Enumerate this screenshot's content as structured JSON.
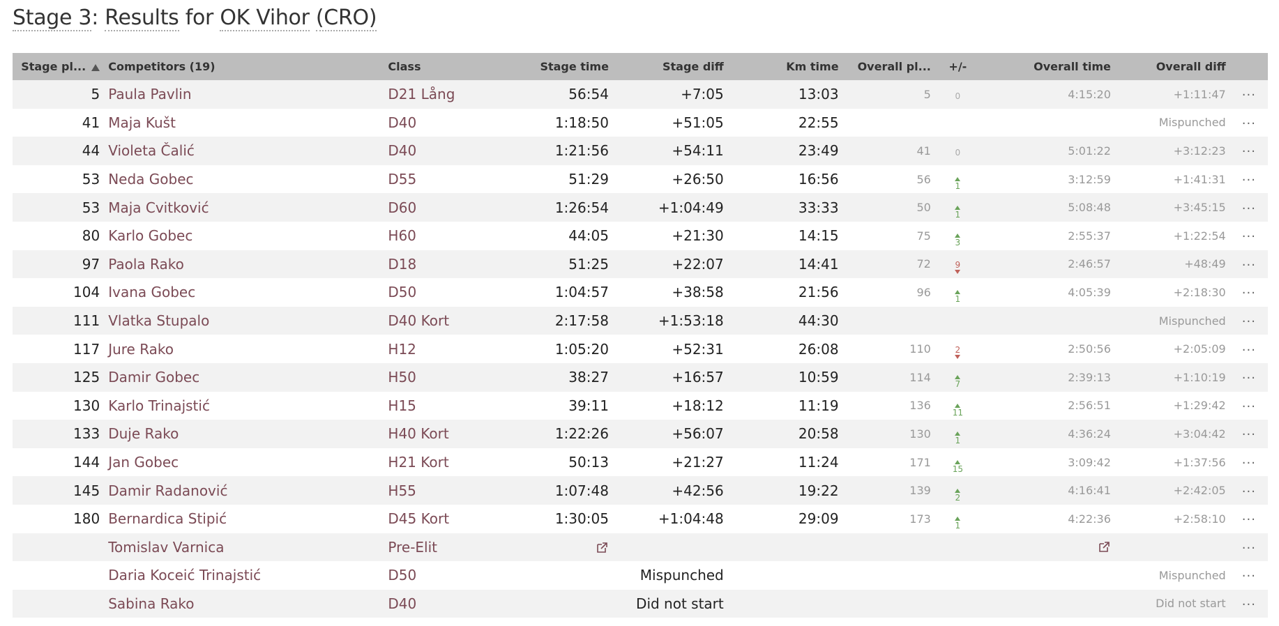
{
  "title": {
    "prefix": "Stage 3",
    "colon": ": ",
    "word1": "Results",
    "word2": " for ",
    "club": "OK Vihor",
    "space": " ",
    "country": "(CRO)"
  },
  "headers": {
    "stage_place": "Stage pl...",
    "competitors": "Competitors (19)",
    "class": "Class",
    "stage_time": "Stage time",
    "stage_diff": "Stage diff",
    "km_time": "Km time",
    "overall_place": "Overall pl...",
    "plus_minus": "+/-",
    "overall_time": "Overall time",
    "overall_diff": "Overall diff"
  },
  "more_label": "···",
  "colors": {
    "header_bg": "#bdbdbd",
    "link": "#7b4a55",
    "up": "#6aa35a",
    "down": "#c0615a"
  },
  "rows": [
    {
      "place": "5",
      "name": "Paula Pavlin",
      "cls": "D21 Lång",
      "stime": "56:54",
      "sdiff": "+7:05",
      "km": "13:03",
      "opl": "5",
      "chg": "0",
      "dir": "zero",
      "otime": "4:15:20",
      "odiff": "+1:11:47"
    },
    {
      "place": "41",
      "name": "Maja Kušt",
      "cls": "D40",
      "stime": "1:18:50",
      "sdiff": "+51:05",
      "km": "22:55",
      "opl": "",
      "chg": "",
      "dir": "",
      "otime": "",
      "odiff": "Mispunched"
    },
    {
      "place": "44",
      "name": "Violeta Čalić",
      "cls": "D40",
      "stime": "1:21:56",
      "sdiff": "+54:11",
      "km": "23:49",
      "opl": "41",
      "chg": "0",
      "dir": "zero",
      "otime": "5:01:22",
      "odiff": "+3:12:23"
    },
    {
      "place": "53",
      "name": "Neda Gobec",
      "cls": "D55",
      "stime": "51:29",
      "sdiff": "+26:50",
      "km": "16:56",
      "opl": "56",
      "chg": "1",
      "dir": "up",
      "otime": "3:12:59",
      "odiff": "+1:41:31"
    },
    {
      "place": "53",
      "name": "Maja Cvitković",
      "cls": "D60",
      "stime": "1:26:54",
      "sdiff": "+1:04:49",
      "km": "33:33",
      "opl": "50",
      "chg": "1",
      "dir": "up",
      "otime": "5:08:48",
      "odiff": "+3:45:15"
    },
    {
      "place": "80",
      "name": "Karlo Gobec",
      "cls": "H60",
      "stime": "44:05",
      "sdiff": "+21:30",
      "km": "14:15",
      "opl": "75",
      "chg": "3",
      "dir": "up",
      "otime": "2:55:37",
      "odiff": "+1:22:54"
    },
    {
      "place": "97",
      "name": "Paola Rako",
      "cls": "D18",
      "stime": "51:25",
      "sdiff": "+22:07",
      "km": "14:41",
      "opl": "72",
      "chg": "9",
      "dir": "down",
      "otime": "2:46:57",
      "odiff": "+48:49"
    },
    {
      "place": "104",
      "name": "Ivana Gobec",
      "cls": "D50",
      "stime": "1:04:57",
      "sdiff": "+38:58",
      "km": "21:56",
      "opl": "96",
      "chg": "1",
      "dir": "up",
      "otime": "4:05:39",
      "odiff": "+2:18:30"
    },
    {
      "place": "111",
      "name": "Vlatka Stupalo",
      "cls": "D40 Kort",
      "stime": "2:17:58",
      "sdiff": "+1:53:18",
      "km": "44:30",
      "opl": "",
      "chg": "",
      "dir": "",
      "otime": "",
      "odiff": "Mispunched"
    },
    {
      "place": "117",
      "name": "Jure Rako",
      "cls": "H12",
      "stime": "1:05:20",
      "sdiff": "+52:31",
      "km": "26:08",
      "opl": "110",
      "chg": "2",
      "dir": "down",
      "otime": "2:50:56",
      "odiff": "+2:05:09"
    },
    {
      "place": "125",
      "name": "Damir Gobec",
      "cls": "H50",
      "stime": "38:27",
      "sdiff": "+16:57",
      "km": "10:59",
      "opl": "114",
      "chg": "7",
      "dir": "up",
      "otime": "2:39:13",
      "odiff": "+1:10:19"
    },
    {
      "place": "130",
      "name": "Karlo Trinajstić",
      "cls": "H15",
      "stime": "39:11",
      "sdiff": "+18:12",
      "km": "11:19",
      "opl": "136",
      "chg": "11",
      "dir": "up",
      "otime": "2:56:51",
      "odiff": "+1:29:42"
    },
    {
      "place": "133",
      "name": "Duje Rako",
      "cls": "H40 Kort",
      "stime": "1:22:26",
      "sdiff": "+56:07",
      "km": "20:58",
      "opl": "130",
      "chg": "1",
      "dir": "up",
      "otime": "4:36:24",
      "odiff": "+3:04:42"
    },
    {
      "place": "144",
      "name": "Jan Gobec",
      "cls": "H21 Kort",
      "stime": "50:13",
      "sdiff": "+21:27",
      "km": "11:24",
      "opl": "171",
      "chg": "15",
      "dir": "up",
      "otime": "3:09:42",
      "odiff": "+1:37:56"
    },
    {
      "place": "145",
      "name": "Damir Radanović",
      "cls": "H55",
      "stime": "1:07:48",
      "sdiff": "+42:56",
      "km": "19:22",
      "opl": "139",
      "chg": "2",
      "dir": "up",
      "otime": "4:16:41",
      "odiff": "+2:42:05"
    },
    {
      "place": "180",
      "name": "Bernardica Stipić",
      "cls": "D45 Kort",
      "stime": "1:30:05",
      "sdiff": "+1:04:48",
      "km": "29:09",
      "opl": "173",
      "chg": "1",
      "dir": "up",
      "otime": "4:22:36",
      "odiff": "+2:58:10"
    },
    {
      "place": "",
      "name": "Tomislav Varnica",
      "cls": "Pre-Elit",
      "stime": "",
      "sdiff": "",
      "km": "",
      "opl": "",
      "chg": "",
      "dir": "",
      "otime": "",
      "odiff": "",
      "ext": true
    },
    {
      "place": "",
      "name": "Daria Koceić Trinajstić",
      "cls": "D50",
      "stime": "",
      "sdiff": "Mispunched",
      "km": "",
      "opl": "",
      "chg": "",
      "dir": "",
      "otime": "",
      "odiff": "Mispunched"
    },
    {
      "place": "",
      "name": "Sabina Rako",
      "cls": "D40",
      "stime": "",
      "sdiff": "Did not start",
      "km": "",
      "opl": "",
      "chg": "",
      "dir": "",
      "otime": "",
      "odiff": "Did not start"
    }
  ]
}
